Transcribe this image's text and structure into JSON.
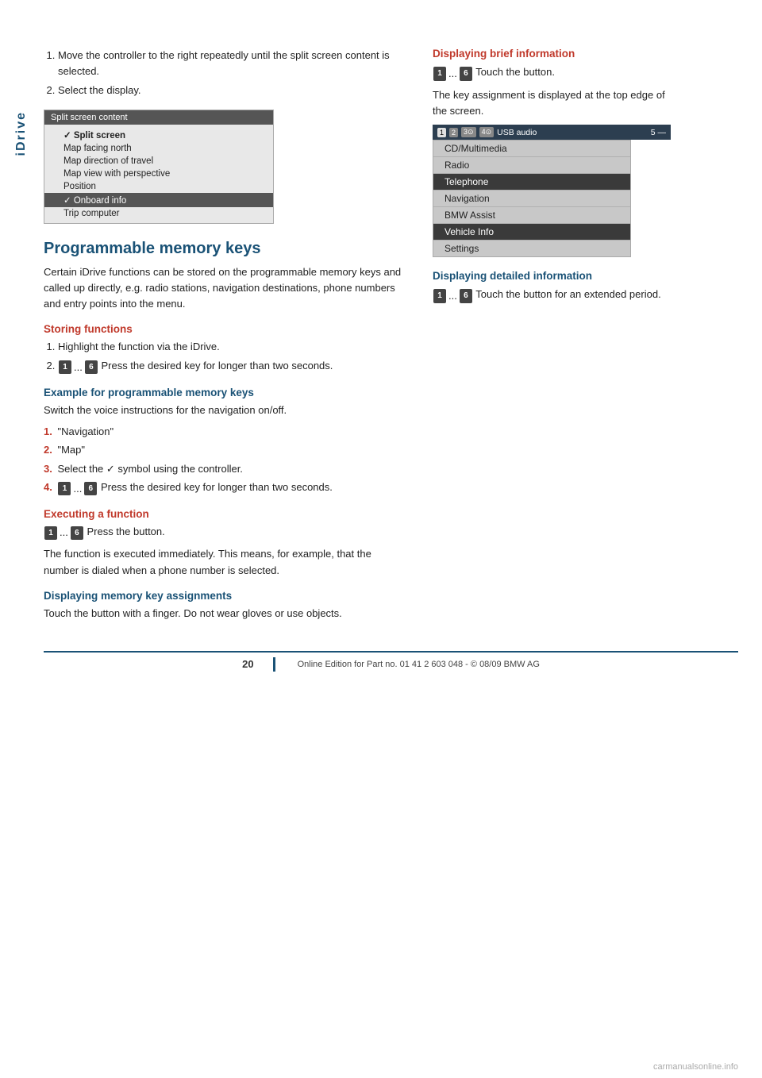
{
  "sidebar": {
    "label": "iDrive"
  },
  "step1": {
    "text1": "Move the controller to the right repeatedly until the split screen content is selected.",
    "text2": "Select the display."
  },
  "split_screen": {
    "title": "Split screen content",
    "items": [
      {
        "label": "Split screen",
        "type": "checked"
      },
      {
        "label": "Map facing north",
        "type": "normal"
      },
      {
        "label": "Map direction of travel",
        "type": "normal"
      },
      {
        "label": "Map view with perspective",
        "type": "normal"
      },
      {
        "label": "Position",
        "type": "normal"
      },
      {
        "label": "Onboard info",
        "type": "highlighted"
      },
      {
        "label": "Trip computer",
        "type": "normal"
      }
    ]
  },
  "programmable_section": {
    "heading": "Programmable memory keys",
    "body": "Certain iDrive functions can be stored on the programmable memory keys and called up directly, e.g. radio stations, navigation destinations, phone numbers and entry points into the menu."
  },
  "storing_functions": {
    "heading": "Storing functions",
    "step1": "Highlight the function via the iDrive.",
    "step2_prefix": "... ",
    "step2_suffix": " Press the desired key for longer than two seconds.",
    "key1": "1",
    "key2": "6"
  },
  "example_section": {
    "heading": "Example for programmable memory keys",
    "body": "Switch the voice instructions for the navigation on/off.",
    "items": [
      {
        "num": "1.",
        "text": "\"Navigation\""
      },
      {
        "num": "2.",
        "text": "\"Map\""
      },
      {
        "num": "3.",
        "text": "Select the ✓ symbol using the controller."
      },
      {
        "num": "4.",
        "text": "...   Press the desired key for longer than two seconds.",
        "has_keys": true
      }
    ],
    "key1": "1",
    "key2": "6"
  },
  "executing_section": {
    "heading": "Executing a function",
    "key1": "1",
    "key2": "6",
    "suffix": " Press the button.",
    "body": "The function is executed immediately. This means, for example, that the number is dialed when a phone number is selected."
  },
  "displaying_memory_section": {
    "heading": "Displaying memory key assignments",
    "body": "Touch the button with a finger. Do not wear gloves or use objects."
  },
  "right_brief": {
    "heading": "Displaying brief information",
    "key1": "1",
    "key2": "6",
    "suffix": " Touch the button.",
    "body": "The key assignment is displayed at the top edge of the screen."
  },
  "usb_bar": {
    "items": [
      "1",
      "2",
      "3",
      "4"
    ],
    "label": "USB audio",
    "page": "5"
  },
  "menu_items": [
    {
      "label": "CD/Multimedia",
      "type": "normal"
    },
    {
      "label": "Radio",
      "type": "normal"
    },
    {
      "label": "Telephone",
      "type": "highlighted"
    },
    {
      "label": "Navigation",
      "type": "normal"
    },
    {
      "label": "BMW Assist",
      "type": "normal"
    },
    {
      "label": "Vehicle Info",
      "type": "highlighted"
    },
    {
      "label": "Settings",
      "type": "normal"
    }
  ],
  "right_detailed": {
    "heading": "Displaying detailed information",
    "key1": "1",
    "key2": "6",
    "body": " Touch the button for an extended period."
  },
  "footer": {
    "page": "20",
    "text": "Online Edition for Part no. 01 41 2 603 048 - © 08/09 BMW AG"
  }
}
